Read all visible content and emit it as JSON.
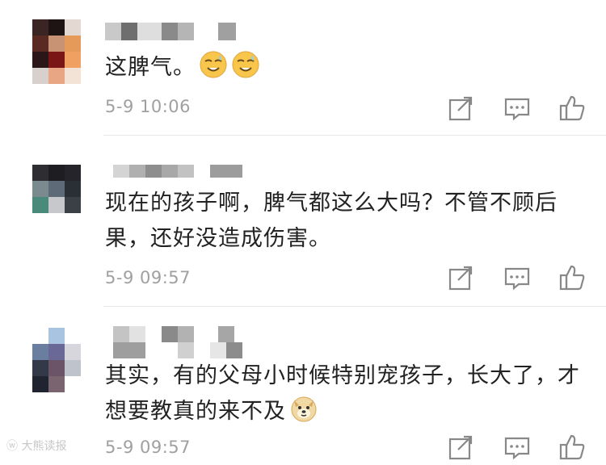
{
  "comments": [
    {
      "text": "这脾气。",
      "emoji": [
        "sweat-smile-emoji",
        "sweat-smile-emoji"
      ],
      "time": "5-9 10:06"
    },
    {
      "text": "现在的孩子啊，脾气都这么大吗？不管不顾后果，还好没造成伤害。",
      "emoji": [],
      "time": "5-9 09:57"
    },
    {
      "text": "其实，有的父母小时候特别宠孩子，长大了，才想要教真的来不及",
      "emoji": [
        "doge-emoji"
      ],
      "time": "5-9 09:57"
    }
  ],
  "actions": [
    "share-icon",
    "comment-icon",
    "like-icon"
  ],
  "watermark": "大熊读报",
  "colors": {
    "text": "#222222",
    "time": "#a0a0a0",
    "icon": "#888888",
    "emoji_face": "#f7c64a"
  }
}
